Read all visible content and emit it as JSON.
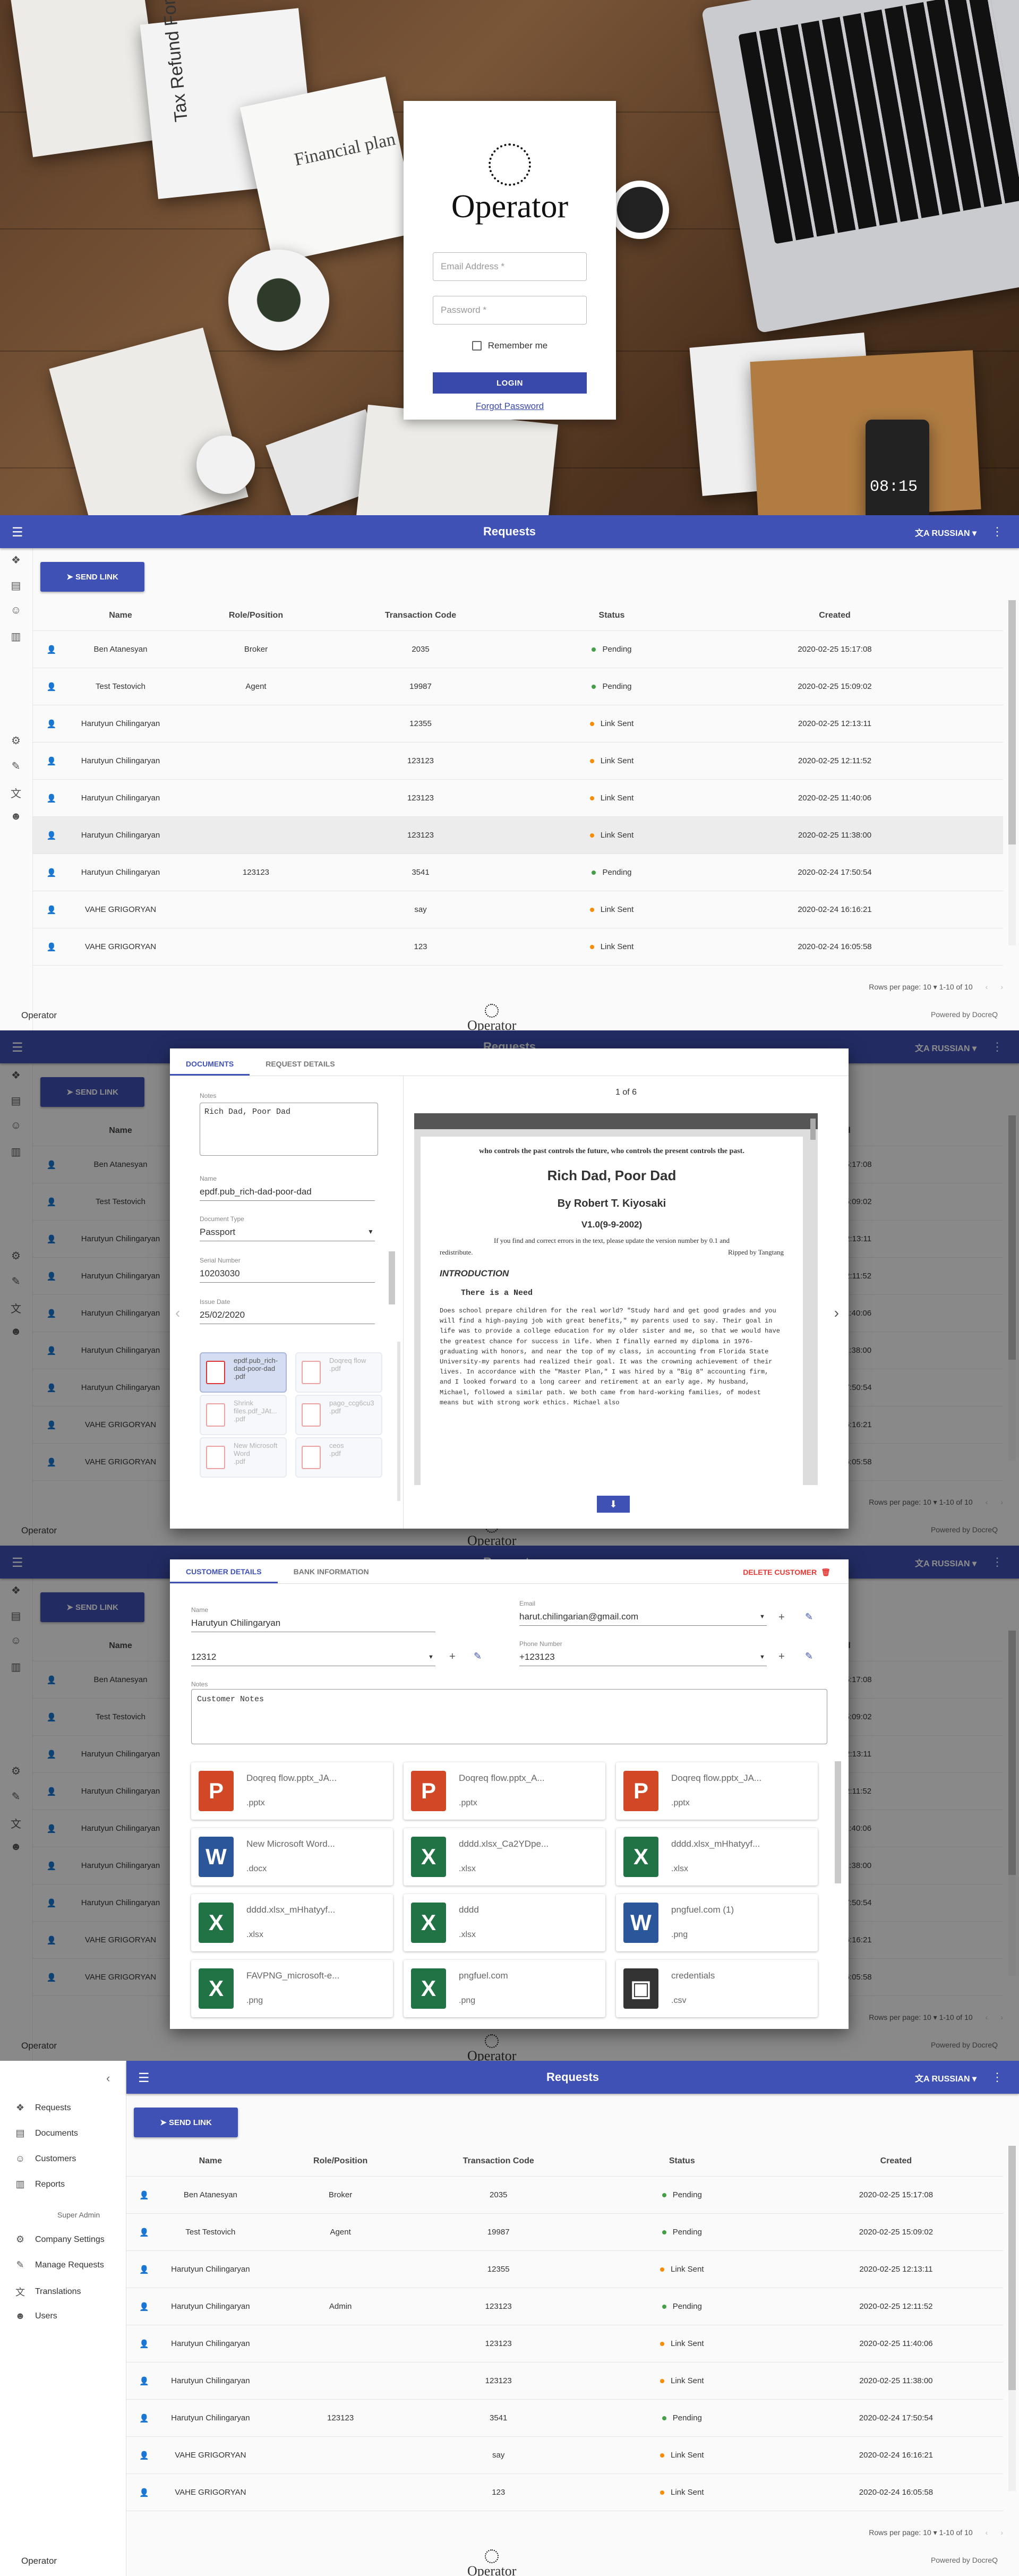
{
  "login": {
    "logo_text": "Operator",
    "email_placeholder": "Email Address *",
    "password_placeholder": "Password *",
    "remember_label": "Remember me",
    "login_label": "LOGIN",
    "forgot_label": "Forgot Password",
    "background_texts": {
      "tax_form": "Tax Refund Form",
      "financial_plan": "Financial plan",
      "clock": "08:15"
    }
  },
  "app": {
    "title": "Requests",
    "language": "RUSSIAN",
    "send_link_label": "SEND LINK",
    "columns": [
      "Name",
      "Role/Position",
      "Transaction Code",
      "Status",
      "Created"
    ],
    "rows": [
      {
        "name": "Ben Atanesyan",
        "role": "Broker",
        "code": "2035",
        "status": "Pending",
        "created": "2020-02-25 15:17:08"
      },
      {
        "name": "Test Testovich",
        "role": "Agent",
        "code": "19987",
        "status": "Pending",
        "created": "2020-02-25 15:09:02"
      },
      {
        "name": "Harutyun Chilingaryan",
        "role": "",
        "code": "12355",
        "status": "Link Sent",
        "created": "2020-02-25 12:13:11"
      },
      {
        "name": "Harutyun Chilingaryan",
        "role": "",
        "code": "123123",
        "status": "Link Sent",
        "created": "2020-02-25 12:11:52"
      },
      {
        "name": "Harutyun Chilingaryan",
        "role": "",
        "code": "123123",
        "status": "Link Sent",
        "created": "2020-02-25 11:40:06"
      },
      {
        "name": "Harutyun Chilingaryan",
        "role": "",
        "code": "123123",
        "status": "Link Sent",
        "created": "2020-02-25 11:38:00"
      },
      {
        "name": "Harutyun Chilingaryan",
        "role": "123123",
        "code": "3541",
        "status": "Pending",
        "created": "2020-02-24 17:50:54"
      },
      {
        "name": "VAHE GRIGORYAN",
        "role": "",
        "code": "say",
        "status": "Link Sent",
        "created": "2020-02-24 16:16:21"
      },
      {
        "name": "VAHE GRIGORYAN",
        "role": "",
        "code": "123",
        "status": "Link Sent",
        "created": "2020-02-24 16:05:58"
      }
    ],
    "rows_admin": [
      "Broker",
      "Agent",
      "",
      "Admin",
      "",
      "",
      "123123",
      "",
      ""
    ],
    "rows_admin_status": [
      "Pending",
      "Pending",
      "Link Sent",
      "Pending",
      "Link Sent",
      "Link Sent",
      "Pending",
      "Link Sent",
      "Link Sent"
    ],
    "rows_per_page_label": "Rows per page:",
    "rows_per_page": "10",
    "range": "1-10 of 10",
    "footer_left": "Operator",
    "footer_logo": "Operator",
    "footer_right": "Powered by DocreQ",
    "status_colors": {
      "Pending": "#43a047",
      "Link Sent": "#fb8c00"
    }
  },
  "documents_dialog": {
    "tabs": [
      "DOCUMENTS",
      "REQUEST DETAILS"
    ],
    "notes_label": "Notes",
    "notes_value": "Rich Dad, Poor Dad",
    "name_label": "Name",
    "name_value": "epdf.pub_rich-dad-poor-dad",
    "doctype_label": "Document Type",
    "doctype_value": "Passport",
    "serial_label": "Serial Number",
    "serial_value": "10203030",
    "issue_label": "Issue Date",
    "issue_value": "25/02/2020",
    "thumbs": [
      {
        "line1": "epdf.pub_rich-",
        "line2": "dad-poor-dad",
        "line3": ".pdf"
      },
      {
        "line1": "Doqreq flow",
        "line2": "",
        "line3": ".pdf"
      },
      {
        "line1": "Shrink",
        "line2": "files.pdf_JAt...",
        "line3": ".pdf"
      },
      {
        "line1": "pago_ccg6cu3",
        "line2": "",
        "line3": ".pdf"
      },
      {
        "line1": "New Microsoft",
        "line2": "Word",
        "line3": ".pdf"
      },
      {
        "line1": "ceos",
        "line2": "",
        "line3": ".pdf"
      }
    ],
    "page_indicator": "1 of 6",
    "pdf": {
      "top_line": "who controls the past controls the future, who controls the present controls the past.",
      "title": "Rich Dad, Poor Dad",
      "author": "By Robert T. Kiyosaki",
      "version": "V1.0(9-9-2002)",
      "note1": "If you find and correct errors in the text, please update the version number by 0.1 and",
      "note2": "redistribute.",
      "note3": "Ripped by Tangtang",
      "intro": "INTRODUCTION",
      "need": "There is a Need",
      "body": "Does school prepare children for the real world? \"Study hard and get good grades and you will find a high-paying job with great benefits,\" my parents used to say. Their goal in life was to provide a college education for my older sister and me, so that we would have the greatest chance for success in life. When I finally earned my diploma in 1976-graduating with honors, and near the top of my class, in accounting from Florida State University-my parents had realized their goal. It was the crowning achievement of their lives. In accordance with the \"Master Plan,\" I was hired by a \"Big 8\" accounting firm, and I looked forward to a long career and retirement at an early age. My husband, Michael, followed a similar path. We both came from hard-working families, of modest means but with strong work ethics. Michael also"
    }
  },
  "customer_dialog": {
    "tabs": [
      "CUSTOMER DETAILS",
      "BANK INFORMATION"
    ],
    "delete_label": "DELETE CUSTOMER",
    "name_label": "Name",
    "name_value": "Harutyun Chilingaryan",
    "email_label": "Email",
    "email_value": "harut.chilingarian@gmail.com",
    "id_value": "12312",
    "phone_label": "Phone Number",
    "phone_value": "+123123",
    "notes_label": "Notes",
    "notes_value": "Customer Notes",
    "files": [
      {
        "name": "Doqreq flow.pptx_JA...",
        "ext": ".pptx",
        "icon": "P",
        "color": "#d24726"
      },
      {
        "name": "Doqreq flow.pptx_A...",
        "ext": ".pptx",
        "icon": "P",
        "color": "#d24726"
      },
      {
        "name": "Doqreq flow.pptx_JA...",
        "ext": ".pptx",
        "icon": "P",
        "color": "#d24726"
      },
      {
        "name": "New Microsoft Word...",
        "ext": ".docx",
        "icon": "W",
        "color": "#2b579a"
      },
      {
        "name": "dddd.xlsx_Ca2YDpe...",
        "ext": ".xlsx",
        "icon": "X",
        "color": "#217346"
      },
      {
        "name": "dddd.xlsx_mHhatyyf...",
        "ext": ".xlsx",
        "icon": "X",
        "color": "#217346"
      },
      {
        "name": "dddd.xlsx_mHhatyyf...",
        "ext": ".xlsx",
        "icon": "X",
        "color": "#217346"
      },
      {
        "name": "dddd",
        "ext": ".xlsx",
        "icon": "X",
        "color": "#217346"
      },
      {
        "name": "pngfuel.com (1)",
        "ext": ".png",
        "icon": "W",
        "color": "#2b579a"
      },
      {
        "name": "FAVPNG_microsoft-e...",
        "ext": ".png",
        "icon": "X",
        "color": "#217346"
      },
      {
        "name": "pngfuel.com",
        "ext": ".png",
        "icon": "X",
        "color": "#217346"
      },
      {
        "name": "credentials",
        "ext": ".csv",
        "icon": "▣",
        "color": "#333333"
      }
    ]
  },
  "sidebar": {
    "items": [
      "Requests",
      "Documents",
      "Customers",
      "Reports"
    ],
    "admin_header": "Super Admin",
    "admin_items": [
      "Company Settings",
      "Manage Requests",
      "Translations",
      "Users"
    ]
  }
}
